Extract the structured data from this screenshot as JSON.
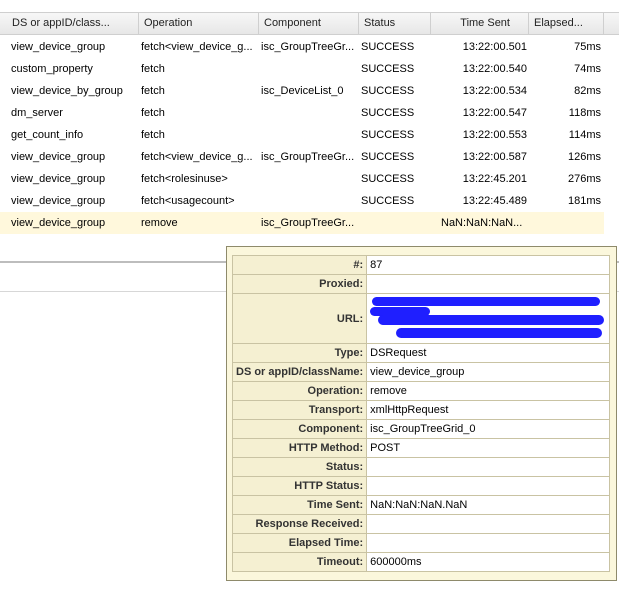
{
  "grid": {
    "columns": [
      {
        "label": "DS or appID/class..."
      },
      {
        "label": "Operation"
      },
      {
        "label": "Component"
      },
      {
        "label": "Status"
      },
      {
        "label": "Time Sent"
      },
      {
        "label": "Elapsed..."
      }
    ],
    "rows": [
      {
        "ds": "view_device_group",
        "op": "fetch<view_device_g...",
        "comp": "isc_GroupTreeGr...",
        "status": "SUCCESS",
        "time": "13:22:00.501",
        "elapsed": "75ms"
      },
      {
        "ds": "custom_property",
        "op": "fetch",
        "comp": "",
        "status": "SUCCESS",
        "time": "13:22:00.540",
        "elapsed": "74ms"
      },
      {
        "ds": "view_device_by_group",
        "op": "fetch",
        "comp": "isc_DeviceList_0",
        "status": "SUCCESS",
        "time": "13:22:00.534",
        "elapsed": "82ms"
      },
      {
        "ds": "dm_server",
        "op": "fetch",
        "comp": "",
        "status": "SUCCESS",
        "time": "13:22:00.547",
        "elapsed": "118ms"
      },
      {
        "ds": "get_count_info",
        "op": "fetch",
        "comp": "",
        "status": "SUCCESS",
        "time": "13:22:00.553",
        "elapsed": "114ms"
      },
      {
        "ds": "view_device_group",
        "op": "fetch<view_device_g...",
        "comp": "isc_GroupTreeGr...",
        "status": "SUCCESS",
        "time": "13:22:00.587",
        "elapsed": "126ms"
      },
      {
        "ds": "view_device_group",
        "op": "fetch<rolesinuse>",
        "comp": "",
        "status": "SUCCESS",
        "time": "13:22:45.201",
        "elapsed": "276ms"
      },
      {
        "ds": "view_device_group",
        "op": "fetch<usagecount>",
        "comp": "",
        "status": "SUCCESS",
        "time": "13:22:45.489",
        "elapsed": "181ms"
      },
      {
        "ds": "view_device_group",
        "op": "remove",
        "comp": "isc_GroupTreeGr...",
        "status": "",
        "time": "NaN:NaN:NaN...",
        "elapsed": ""
      }
    ]
  },
  "detail": {
    "rows": [
      {
        "label": "#:",
        "value": "87"
      },
      {
        "label": "Proxied:",
        "value": ""
      },
      {
        "label": "URL:",
        "value": ""
      },
      {
        "label": "Type:",
        "value": "DSRequest"
      },
      {
        "label": "DS or appID/className:",
        "value": "view_device_group"
      },
      {
        "label": "Operation:",
        "value": "remove"
      },
      {
        "label": "Transport:",
        "value": "xmlHttpRequest"
      },
      {
        "label": "Component:",
        "value": "isc_GroupTreeGrid_0"
      },
      {
        "label": "HTTP Method:",
        "value": "POST"
      },
      {
        "label": "Status:",
        "value": ""
      },
      {
        "label": "HTTP Status:",
        "value": ""
      },
      {
        "label": "Time Sent:",
        "value": "NaN:NaN:NaN.NaN"
      },
      {
        "label": "Response Received:",
        "value": ""
      },
      {
        "label": "Elapsed Time:",
        "value": ""
      },
      {
        "label": "Timeout:",
        "value": "600000ms"
      }
    ]
  },
  "colors": {
    "selected_row": "#fff8dc",
    "tooltip_bg": "#fbf7dc",
    "redaction": "#1f1fff"
  }
}
